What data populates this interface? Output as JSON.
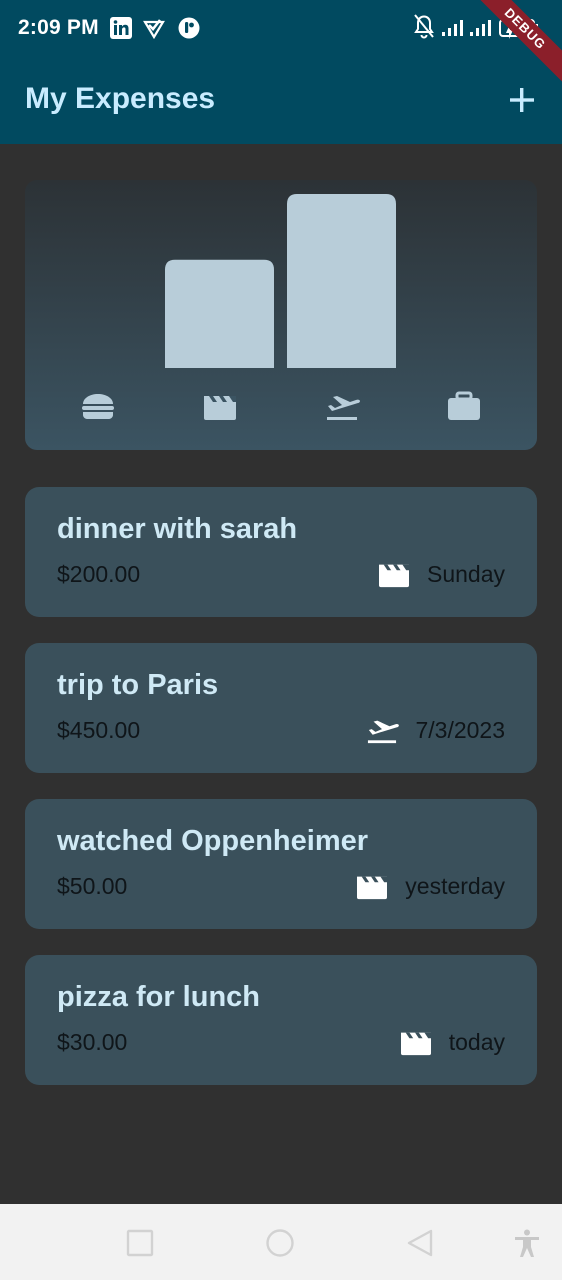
{
  "status_bar": {
    "time": "2:09 PM",
    "left_icons": [
      "linkedin-icon",
      "check-heart-icon",
      "app-notification-icon"
    ],
    "right_icons": [
      "bell-off-icon",
      "signal-icon",
      "signal-icon",
      "battery-icon"
    ],
    "battery_text": "52"
  },
  "debug_banner": {
    "label": "DEBUG"
  },
  "app_bar": {
    "title": "My Expenses",
    "add_icon": "plus-icon"
  },
  "chart_data": {
    "type": "bar",
    "categories": [
      "food",
      "leisure",
      "travel",
      "work"
    ],
    "category_icons": [
      "burger-icon",
      "clapperboard-icon",
      "flight-takeoff-icon",
      "briefcase-icon"
    ],
    "values": [
      0,
      280,
      450,
      0
    ],
    "colors": {
      "bar": "#b8cdd9",
      "icon": "#b8cdd9"
    }
  },
  "expenses": [
    {
      "title": "dinner with sarah",
      "amount": "$200.00",
      "category_icon": "clapperboard-icon",
      "date": "Sunday"
    },
    {
      "title": "trip to Paris",
      "amount": "$450.00",
      "category_icon": "flight-takeoff-icon",
      "date": "7/3/2023"
    },
    {
      "title": "watched Oppenheimer",
      "amount": "$50.00",
      "category_icon": "clapperboard-icon",
      "date": "yesterday"
    },
    {
      "title": "pizza for lunch",
      "amount": "$30.00",
      "category_icon": "clapperboard-icon",
      "date": "today"
    }
  ],
  "nav_bar": {
    "buttons": [
      "recent-apps-icon",
      "home-icon",
      "back-icon",
      "accessibility-icon"
    ]
  },
  "colors": {
    "app_bar": "#014a60",
    "background": "#303030",
    "card": "#3a505b",
    "title_text": "#c9ecff"
  }
}
